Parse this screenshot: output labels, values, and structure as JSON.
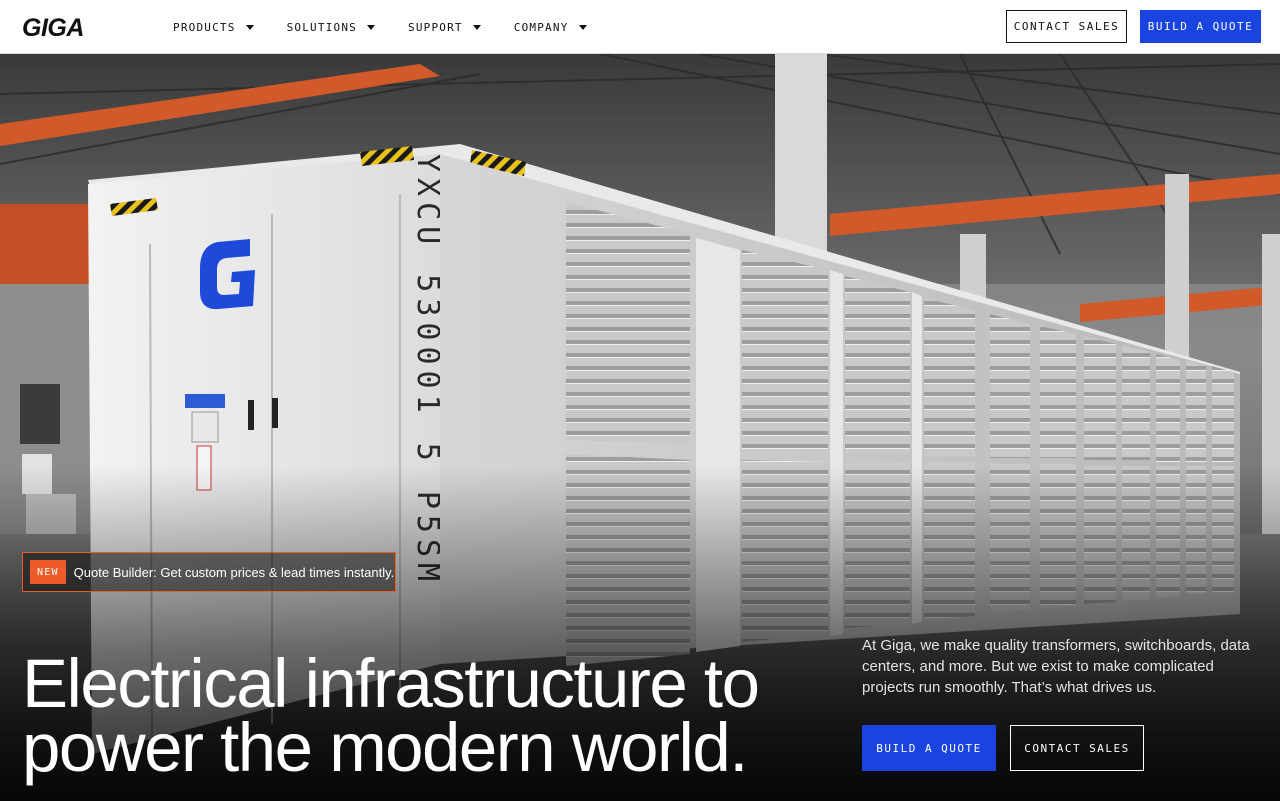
{
  "header": {
    "logo_text": "GIGA",
    "nav": [
      {
        "label": "PRODUCTS",
        "icon": "caret-down-icon"
      },
      {
        "label": "SOLUTIONS",
        "icon": "caret-down-icon"
      },
      {
        "label": "SUPPORT",
        "icon": "caret-down-icon"
      },
      {
        "label": "COMPANY",
        "icon": "caret-down-icon"
      }
    ],
    "contact_sales_label": "CONTACT SALES",
    "build_quote_label": "BUILD A QUOTE"
  },
  "hero": {
    "badge_label": "NEW",
    "badge_text": "Quote Builder: Get custom prices & lead times instantly.",
    "headline_line1": "Electrical infrastructure to",
    "headline_line2": "power the modern world.",
    "intro": "At Giga, we make quality transformers, switchboards, data centers, and more. But we exist to make complicated projects run smoothly. That’s what drives us.",
    "build_quote_label": "BUILD A QUOTE",
    "contact_sales_label": "CONTACT SALES",
    "container_id": "YXCU 530001 5 P5SM"
  },
  "colors": {
    "accent_blue": "#1a44e0",
    "accent_orange": "#f05a28",
    "ink": "#111111"
  }
}
